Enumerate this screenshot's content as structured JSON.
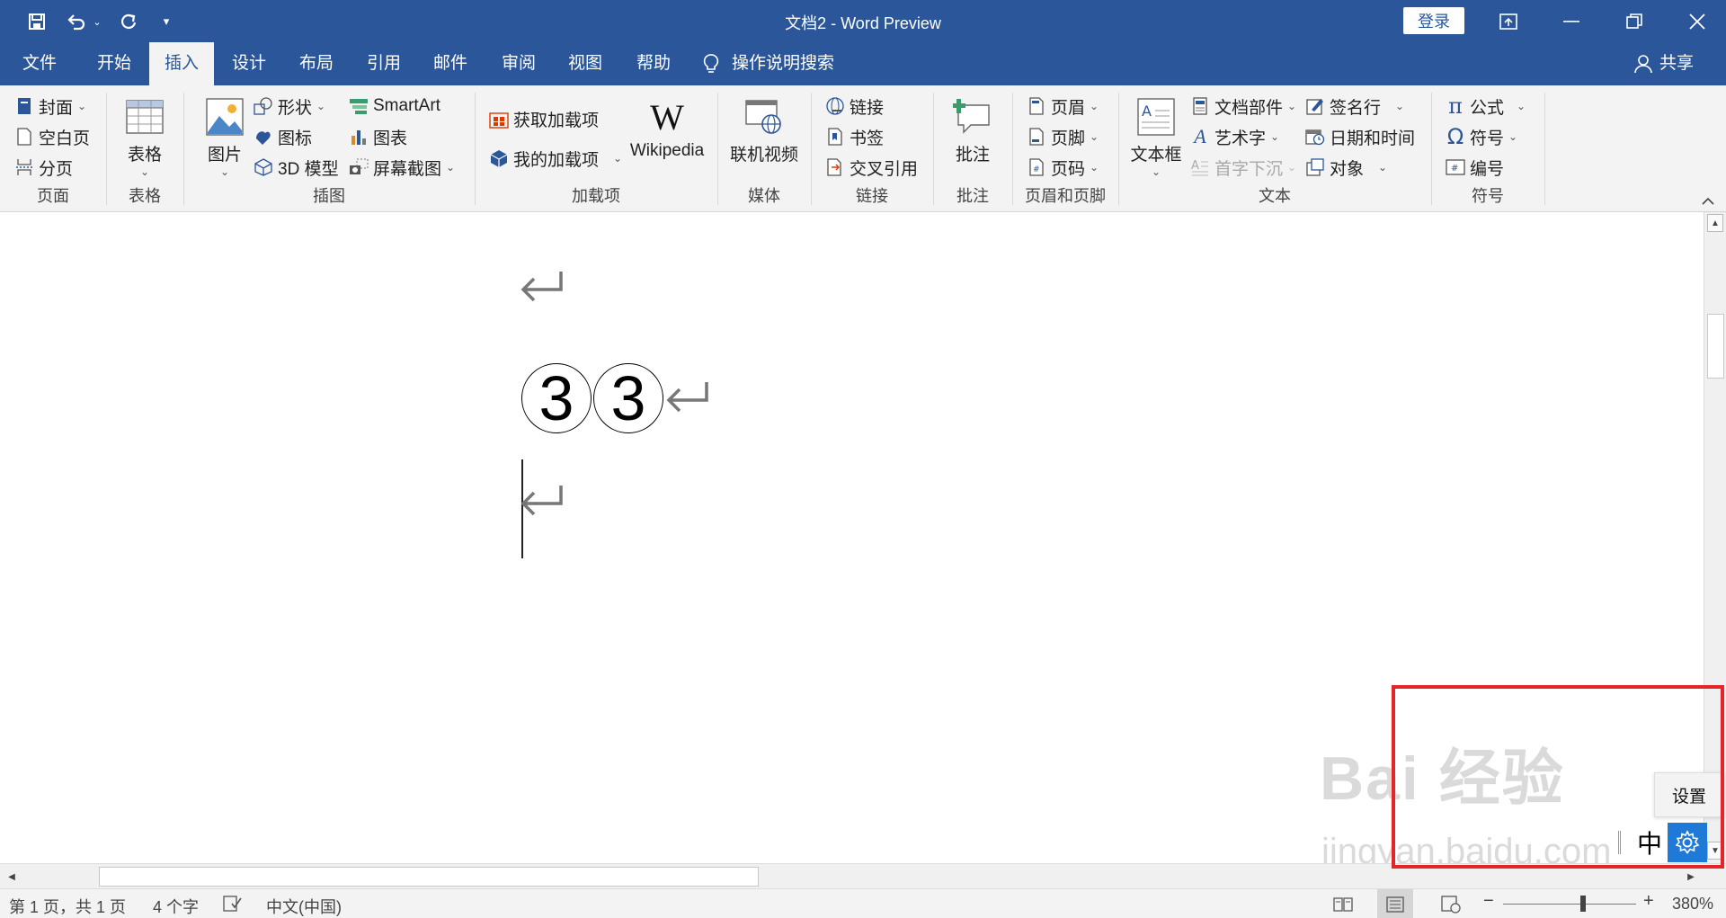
{
  "titlebar": {
    "title": "文档2  -  Word Preview",
    "login_label": "登录",
    "colors": {
      "bar": "#2b579a",
      "highlight": "#e3262a",
      "ime_gear": "#1e7ad6"
    }
  },
  "tabs": [
    {
      "label": "文件",
      "active": false
    },
    {
      "label": "开始",
      "active": false
    },
    {
      "label": "插入",
      "active": true
    },
    {
      "label": "设计",
      "active": false
    },
    {
      "label": "布局",
      "active": false
    },
    {
      "label": "引用",
      "active": false
    },
    {
      "label": "邮件",
      "active": false
    },
    {
      "label": "审阅",
      "active": false
    },
    {
      "label": "视图",
      "active": false
    },
    {
      "label": "帮助",
      "active": false
    }
  ],
  "tell_me": "操作说明搜索",
  "share": "共享",
  "ribbon": {
    "pages": {
      "label": "页面",
      "cover": "封面",
      "blank": "空白页",
      "page_break": "分页"
    },
    "tables": {
      "label": "表格",
      "table": "表格"
    },
    "illustrations": {
      "label": "插图",
      "pictures": "图片",
      "shapes": "形状",
      "icons": "图标",
      "model3d": "3D 模型",
      "smartart": "SmartArt",
      "chart": "图表",
      "screenshot": "屏幕截图"
    },
    "addins": {
      "label": "加载项",
      "get": "获取加载项",
      "my": "我的加载项",
      "wikipedia": "Wikipedia"
    },
    "media": {
      "label": "媒体",
      "video": "联机视频"
    },
    "links": {
      "label": "链接",
      "link": "链接",
      "bookmark": "书签",
      "crossref": "交叉引用"
    },
    "comments": {
      "label": "批注",
      "comment": "批注"
    },
    "header_footer": {
      "label": "页眉和页脚",
      "header": "页眉",
      "footer": "页脚",
      "page_number": "页码"
    },
    "text": {
      "label": "文本",
      "textbox": "文本框",
      "quick_parts": "文档部件",
      "wordart": "艺术字",
      "dropcap": "首字下沉",
      "signature": "签名行",
      "datetime": "日期和时间",
      "object": "对象"
    },
    "symbols": {
      "label": "符号",
      "equation": "公式",
      "symbol": "符号",
      "number": "编号"
    }
  },
  "document": {
    "circled": [
      "3",
      "3"
    ]
  },
  "statusbar": {
    "page": "第 1 页，共 1 页",
    "words": "4 个字",
    "language": "中文(中国)",
    "zoom": "380%",
    "zoom_level": 0.6
  },
  "ime": {
    "settings_tip": "设置",
    "mode": "中"
  },
  "watermark": {
    "text": "Bai 经验",
    "url": "jingyan.baidu.com"
  }
}
